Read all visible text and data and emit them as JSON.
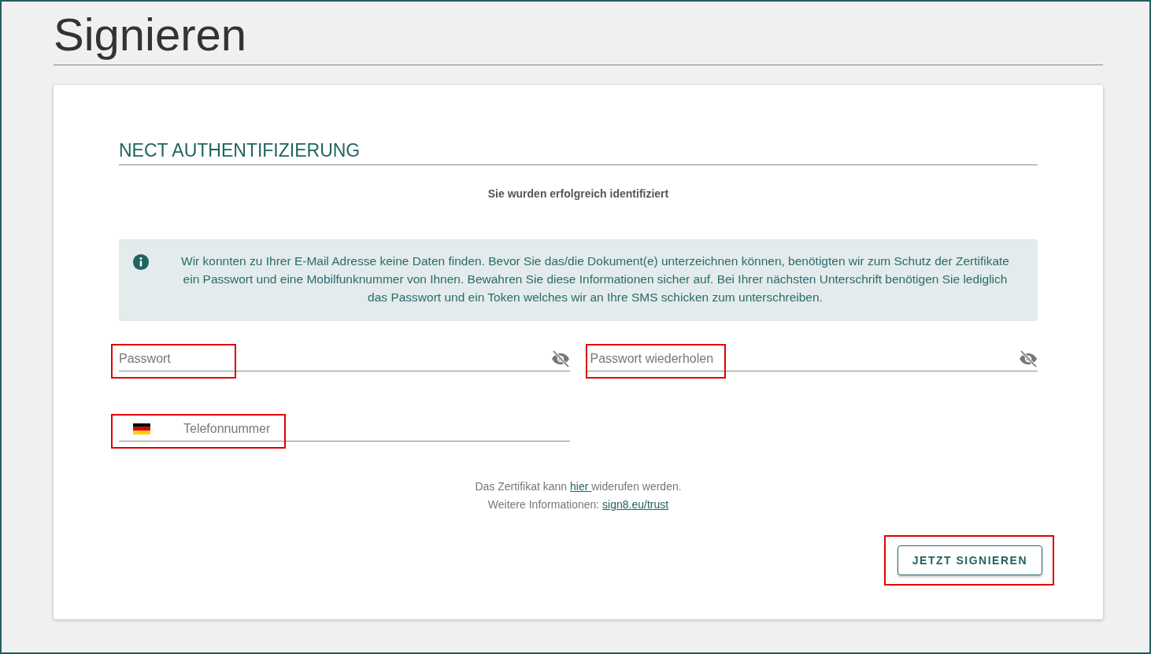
{
  "page_title": "Signieren",
  "section_title": "NECT AUTHENTIFIZIERUNG",
  "status_message": "Sie wurden erfolgreich identifiziert",
  "info_box": {
    "text": "Wir konnten zu Ihrer E-Mail Adresse keine Daten finden. Bevor Sie das/die Dokument(e) unterzeichnen können, benötigten wir zum Schutz der Zertifikate ein Passwort und eine Mobilfunknummer von Ihnen. Bewahren Sie diese Informationen sicher auf. Bei Ihrer nächsten Unterschrift benötigen Sie lediglich das Passwort und ein Token welches wir an Ihre SMS schicken zum unterschreiben."
  },
  "fields": [
    {
      "kind": "password",
      "placeholder": "Passwort",
      "highlighted": true
    },
    {
      "kind": "password",
      "placeholder": "Passwort wiederholen",
      "highlighted": true
    },
    {
      "kind": "phone",
      "placeholder": "Telefonnummer",
      "highlighted": true
    }
  ],
  "footer_lines": [
    {
      "before": "Das Zertifikat kann ",
      "link": "hier ",
      "after": "widerufen werden."
    },
    {
      "before": "Weitere Informationen: ",
      "link": "sign8.eu/trust"
    }
  ],
  "submit_button": {
    "label": "JETZT SIGNIEREN",
    "highlighted": true
  }
}
